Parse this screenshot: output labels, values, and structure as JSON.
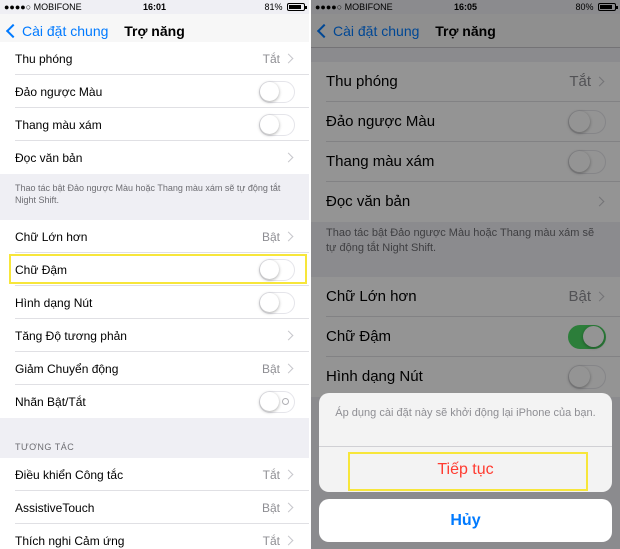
{
  "left": {
    "status": {
      "carrier": "●●●●○ MOBIFONE",
      "wifi": "wifi-icon",
      "time": "16:01",
      "battery_pct": "81%",
      "battery_level": 0.81
    },
    "nav": {
      "back_label": "Cài đặt chung",
      "title": "Trợ năng"
    },
    "rows_group1": [
      {
        "label": "Thu phóng",
        "value": "Tắt"
      },
      {
        "label": "Đảo ngược Màu",
        "toggle": false
      },
      {
        "label": "Thang màu xám",
        "toggle": false
      },
      {
        "label": "Đọc văn bản"
      }
    ],
    "footer": "Thao tác bật Đảo ngược Màu hoặc Thang màu xám sẽ tự động tắt Night Shift.",
    "rows_group2": [
      {
        "label": "Chữ Lớn hơn",
        "value": "Bật"
      },
      {
        "label": "Chữ Đậm",
        "toggle": false
      },
      {
        "label": "Hình dạng Nút",
        "toggle": false
      },
      {
        "label": "Tăng Độ tương phản"
      },
      {
        "label": "Giảm Chuyển động",
        "value": "Bật"
      },
      {
        "label": "Nhãn Bật/Tắt",
        "toggle": false
      }
    ],
    "section_header": "TƯƠNG TÁC",
    "rows_group3": [
      {
        "label": "Điều khiển Công tắc",
        "value": "Tắt"
      },
      {
        "label": "AssistiveTouch",
        "value": "Bật"
      },
      {
        "label": "Thích nghi Cảm ứng",
        "value": "Tắt"
      }
    ]
  },
  "right": {
    "status": {
      "carrier": "●●●●○ MOBIFONE",
      "wifi": "wifi-icon",
      "time": "16:05",
      "battery_pct": "80%",
      "battery_level": 0.8
    },
    "nav": {
      "back_label": "Cài đặt chung",
      "title": "Trợ năng"
    },
    "rows": [
      {
        "label": "Thu phóng",
        "value": "Tắt"
      },
      {
        "label": "Đảo ngược Màu",
        "toggle": false
      },
      {
        "label": "Thang màu xám",
        "toggle": false
      },
      {
        "label": "Đọc văn bản"
      }
    ],
    "footer": "Thao tác bật Đảo ngược Màu hoặc Thang màu xám sẽ tự động tắt Night Shift.",
    "rows2": [
      {
        "label": "Chữ Lớn hơn",
        "value": "Bật"
      },
      {
        "label": "Chữ Đậm",
        "toggle": true
      },
      {
        "label": "Hình dạng Nút",
        "toggle": false
      }
    ],
    "alert": {
      "message": "Áp dụng cài đặt này sẽ khởi động lại iPhone của bạn.",
      "action_label": "Tiếp tục",
      "cancel_label": "Hủy"
    }
  },
  "colors": {
    "accent": "#007aff",
    "destructive": "#ff3b30",
    "toggle_on": "#4cd964",
    "highlight": "#f7e63a"
  }
}
